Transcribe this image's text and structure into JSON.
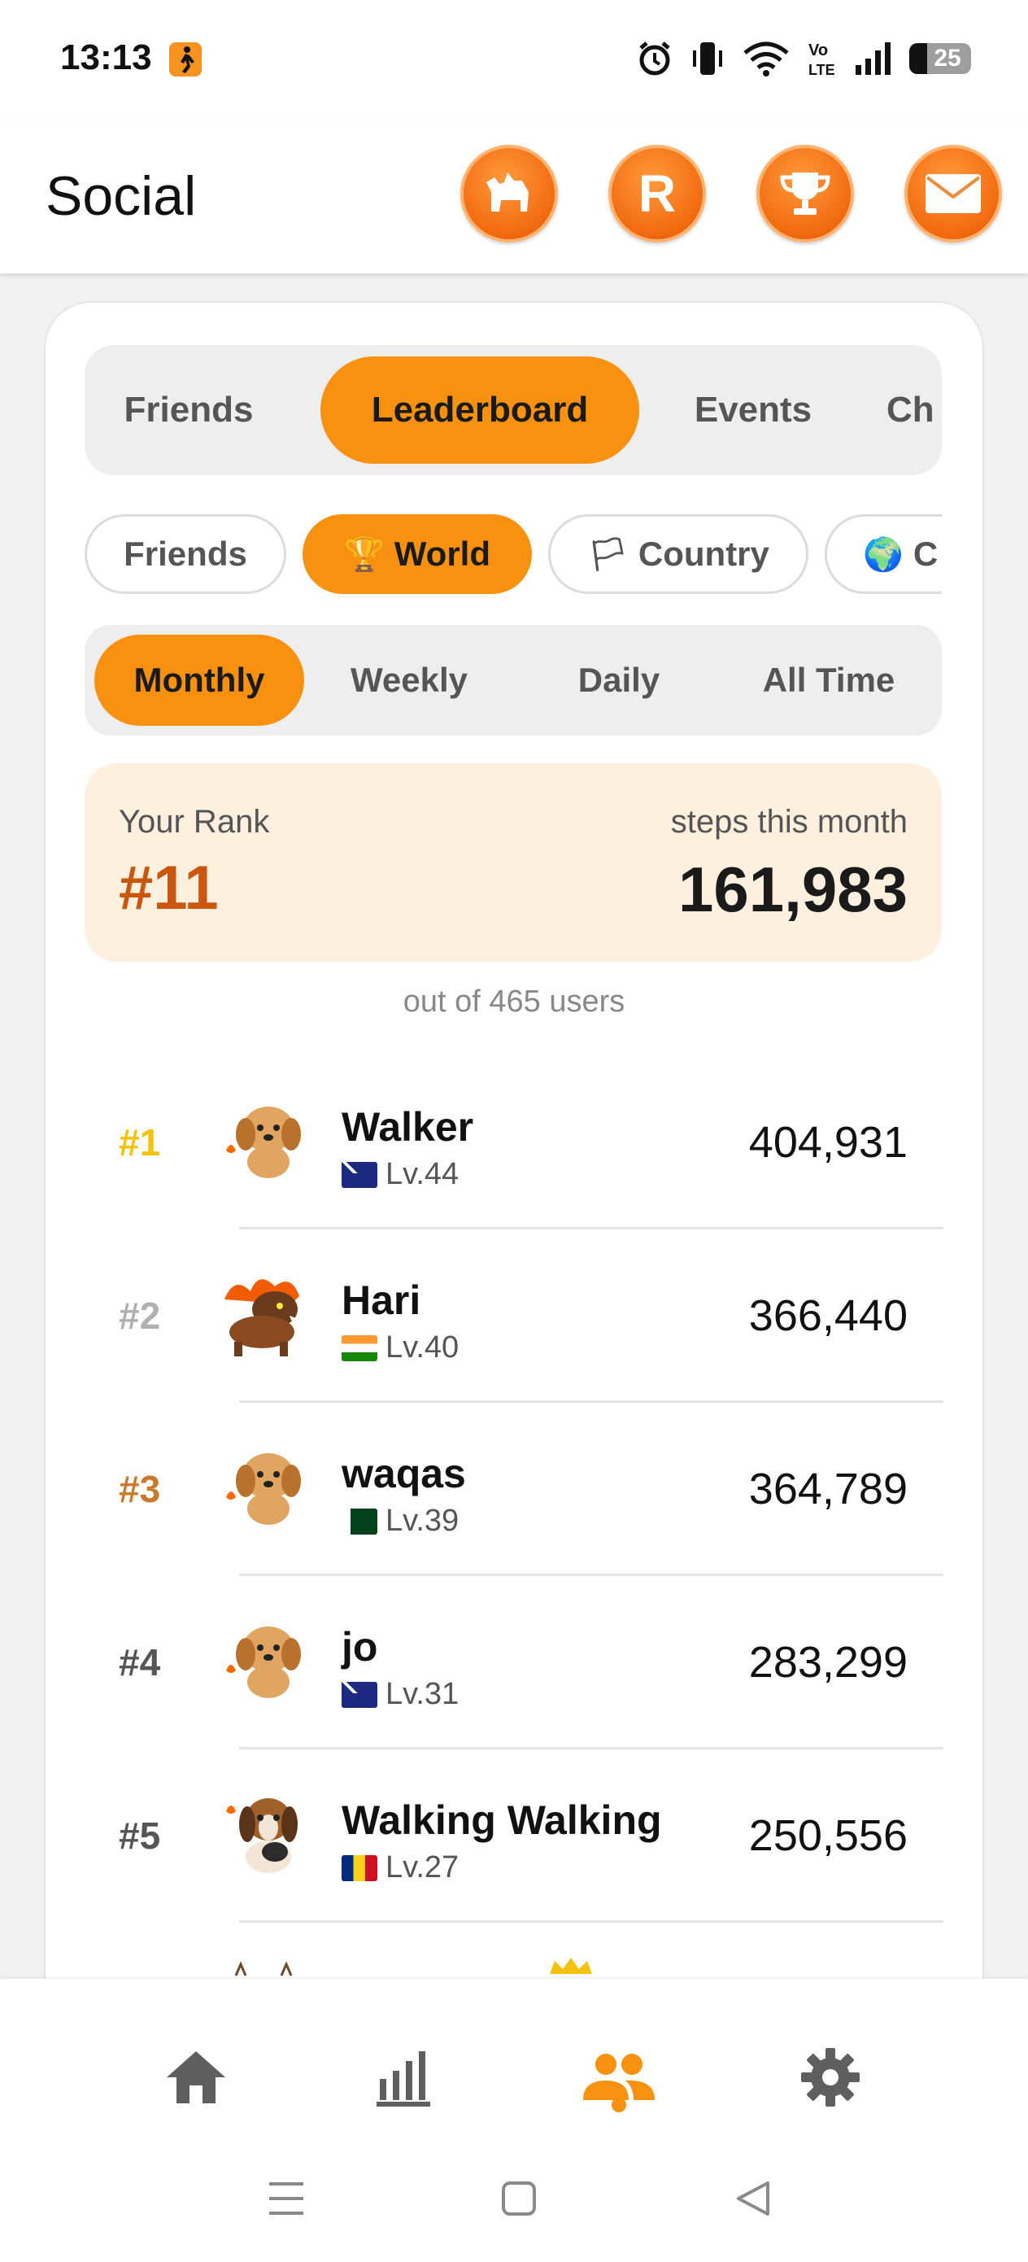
{
  "status_bar": {
    "time": "13:13",
    "battery": "25"
  },
  "header": {
    "title": "Social",
    "buttons": [
      {
        "icon": "dog-icon"
      },
      {
        "icon": "r-badge-icon",
        "label": "R"
      },
      {
        "icon": "trophy-icon"
      },
      {
        "icon": "mail-icon"
      }
    ]
  },
  "tabs": [
    {
      "label": "Friends",
      "active": false
    },
    {
      "label": "Leaderboard",
      "active": true
    },
    {
      "label": "Events",
      "active": false
    },
    {
      "label": "Ch",
      "active": false
    }
  ],
  "filters": [
    {
      "label": "Friends",
      "icon": "",
      "active": false
    },
    {
      "label": "World",
      "icon": "🏆",
      "active": true
    },
    {
      "label": "Country",
      "icon": "🏳",
      "active": false
    },
    {
      "label": "C",
      "icon": "🌍",
      "active": false
    }
  ],
  "periods": [
    {
      "label": "Monthly",
      "active": true
    },
    {
      "label": "Weekly",
      "active": false
    },
    {
      "label": "Daily",
      "active": false
    },
    {
      "label": "All Time",
      "active": false
    }
  ],
  "your_rank": {
    "label": "Your Rank",
    "value": "#11",
    "steps_label": "steps this month",
    "steps_value": "161,983",
    "out_of": "out of 465 users"
  },
  "leaderboard": [
    {
      "rank": "#1",
      "name": "Walker",
      "country": "au",
      "level": "Lv.44",
      "steps": "404,931",
      "rank_color": "#f4c20d",
      "avatar": "puppy-avatar"
    },
    {
      "rank": "#2",
      "name": "Hari",
      "country": "in",
      "level": "Lv.40",
      "steps": "366,440",
      "rank_color": "#b0b0b0",
      "avatar": "fire-dog-avatar"
    },
    {
      "rank": "#3",
      "name": "waqas",
      "country": "pk",
      "level": "Lv.39",
      "steps": "364,789",
      "rank_color": "#c97a2b",
      "avatar": "puppy-avatar"
    },
    {
      "rank": "#4",
      "name": "jo",
      "country": "au",
      "level": "Lv.31",
      "steps": "283,299",
      "rank_color": "#555555",
      "avatar": "puppy-avatar"
    },
    {
      "rank": "#5",
      "name": "Walking Walking",
      "country": "ro",
      "level": "Lv.27",
      "steps": "250,556",
      "rank_color": "#555555",
      "avatar": "beagle-avatar"
    }
  ],
  "bottom_nav": [
    {
      "icon": "home-icon",
      "active": false
    },
    {
      "icon": "stats-icon",
      "active": false
    },
    {
      "icon": "people-icon",
      "active": true
    },
    {
      "icon": "settings-icon",
      "active": false
    }
  ],
  "colors": {
    "accent": "#f7910f",
    "rank_highlight_bg": "#fdf0de",
    "rank_text": "#c9570f"
  }
}
